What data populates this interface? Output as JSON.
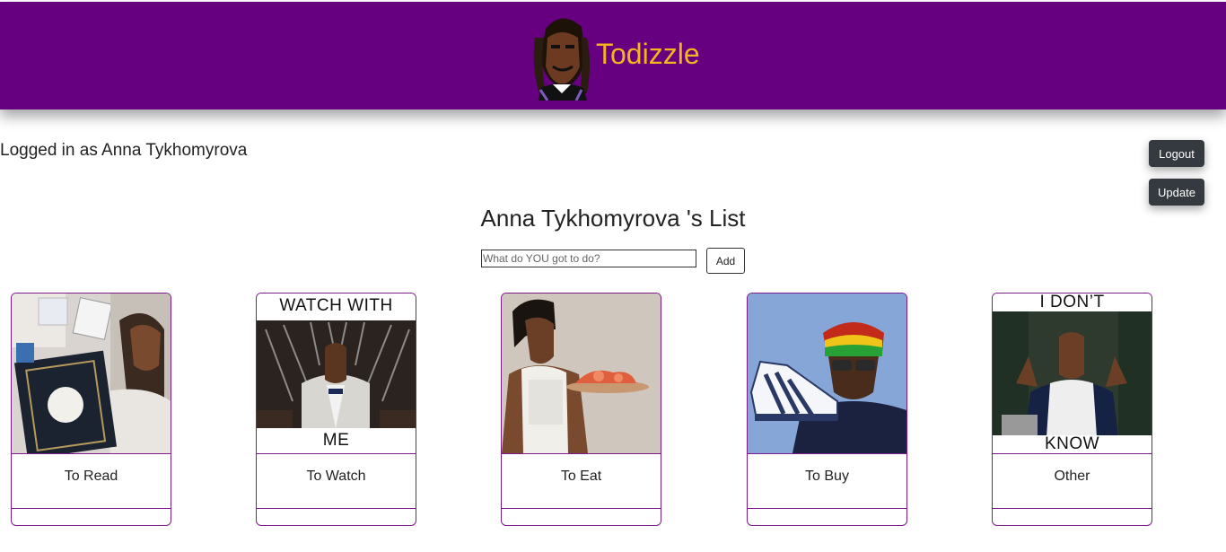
{
  "app": {
    "title": "Todizzle",
    "brand_color": "#670080",
    "brand_text_color": "#f5b31e"
  },
  "header": {
    "logo_icon": "rapper-portrait-icon"
  },
  "user": {
    "logged_in_text": "Logged in as Anna Tykhomyrova"
  },
  "actions": {
    "logout_label": "Logout",
    "update_label": "Update"
  },
  "list": {
    "title": "Anna Tykhomyrova 's List",
    "input_placeholder": "What do YOU got to do?",
    "add_label": "Add"
  },
  "categories": [
    {
      "label": "To Read",
      "image": "reading-book-photo"
    },
    {
      "label": "To Watch",
      "image": "throne-meme",
      "caption_top": "WATCH WITH",
      "caption_bottom": "ME"
    },
    {
      "label": "To Eat",
      "image": "food-platter-photo"
    },
    {
      "label": "To Buy",
      "image": "sneaker-photo"
    },
    {
      "label": "Other",
      "image": "shrug-meme",
      "caption_top": "I DON’T",
      "caption_bottom": "KNOW"
    }
  ]
}
